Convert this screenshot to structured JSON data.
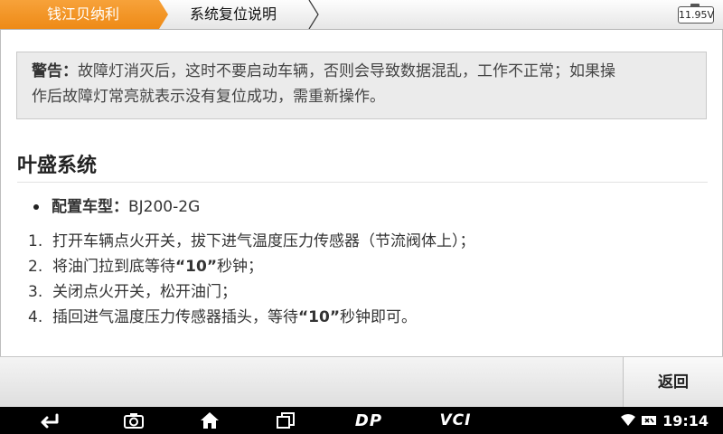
{
  "header": {
    "tabs": [
      {
        "label": "钱江贝纳利",
        "active": true,
        "color": "#f39a29"
      },
      {
        "label": "系统复位说明",
        "active": false
      }
    ],
    "battery_voltage": "11.95V"
  },
  "warning": {
    "label": "警告：",
    "line1": "故障灯消灭后，这时不要启动车辆，否则会导致数据混乱，工作不正常；如果操",
    "line2": "作后故障灯常亮就表示没有复位成功，需重新操作。"
  },
  "section": {
    "title": "叶盛系统",
    "config_label": "配置车型：",
    "config_value": "BJ200-2G",
    "steps": [
      {
        "num": "1.",
        "text": "打开车辆点火开关，拔下进气温度压力传感器（节流阀体上）；"
      },
      {
        "num": "2.",
        "pre": "将油门拉到底等待",
        "bold": "“10”",
        "post": "秒钟；"
      },
      {
        "num": "3.",
        "text": "关闭点火开关，松开油门；"
      },
      {
        "num": "4.",
        "pre": "插回进气温度压力传感器插头，等待",
        "bold": "“10”",
        "post": "秒钟即可。"
      }
    ]
  },
  "actions": {
    "back_label": "返回"
  },
  "navbar": {
    "icons": [
      "back-arrow-icon",
      "camera-icon",
      "home-icon",
      "recent-apps-icon",
      "dp-icon",
      "vci-icon"
    ],
    "dp_label": "DP",
    "vci_label": "VCI",
    "time": "19:14"
  }
}
